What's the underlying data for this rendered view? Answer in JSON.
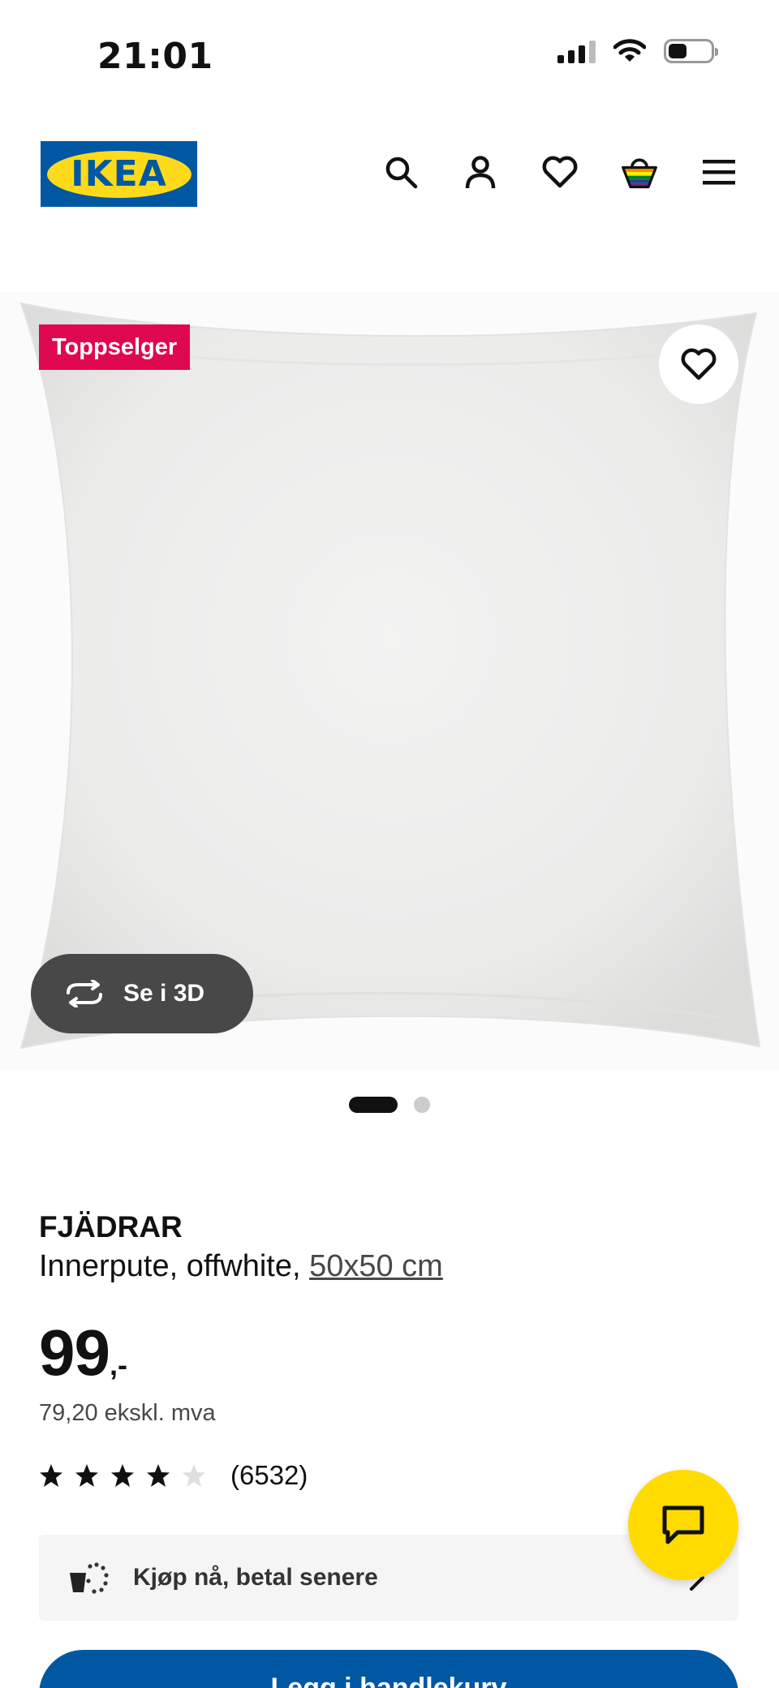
{
  "status_bar": {
    "time": "21:01"
  },
  "header": {
    "logo_text": "IKEA"
  },
  "product_image": {
    "badge": "Toppselger",
    "view_3d_label": "Se i 3D",
    "slide_count": 2,
    "active_slide": 1
  },
  "product": {
    "name": "FJÄDRAR",
    "description": "Innerpute, offwhite,",
    "size": "50x50 cm",
    "price_main": "99",
    "price_suffix": ",-",
    "price_ex_vat": "79,20 ekskl. mva",
    "rating": 4,
    "rating_max": 5,
    "review_count": "(6532)"
  },
  "bnpl": {
    "label": "Kjøp nå, betal senere"
  },
  "cart_button": {
    "label": "Legg i handlekurv"
  },
  "colors": {
    "ikea_blue": "#0058a3",
    "ikea_yellow": "#ffda1a",
    "badge_red": "#e00751",
    "chat_yellow": "#ffdb00"
  }
}
